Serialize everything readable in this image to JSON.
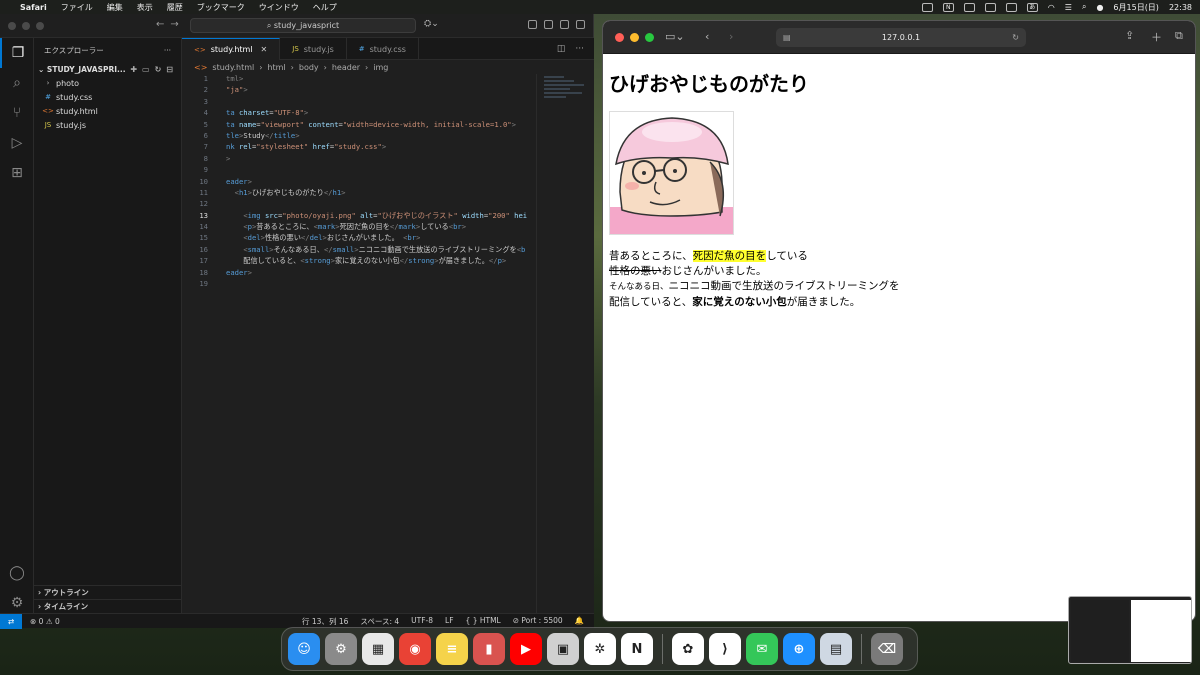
{
  "menubar": {
    "app": "Safari",
    "items": [
      "ファイル",
      "編集",
      "表示",
      "履歴",
      "ブックマーク",
      "ウインドウ",
      "ヘルプ"
    ],
    "ime": "あ",
    "date": "6月15日(日)",
    "time": "22:38"
  },
  "vscode": {
    "command_center": "study_javasprict",
    "explorer_title": "エクスプローラー",
    "root": "STUDY_JAVASPRI...",
    "tree": [
      {
        "name": "photo",
        "kind": "folder",
        "glyph": "›"
      },
      {
        "name": "study.css",
        "kind": "css",
        "glyph": "#"
      },
      {
        "name": "study.html",
        "kind": "html",
        "glyph": "<>"
      },
      {
        "name": "study.js",
        "kind": "js",
        "glyph": "JS"
      }
    ],
    "outline": "アウトライン",
    "timeline": "タイムライン",
    "tabs": [
      {
        "label": "study.html",
        "icon": "<>",
        "active": true
      },
      {
        "label": "study.js",
        "icon": "JS",
        "active": false
      },
      {
        "label": "study.css",
        "icon": "#",
        "active": false
      }
    ],
    "breadcrumb": [
      "study.html",
      "html",
      "body",
      "header",
      "img"
    ],
    "code_lines": [
      {
        "n": "1",
        "html": "<span class='p'>tml&gt;</span>"
      },
      {
        "n": "2",
        "html": "<span class='s'>\"ja\"</span><span class='p'>&gt;</span>"
      },
      {
        "n": "3",
        "html": ""
      },
      {
        "n": "4",
        "html": "<span class='t'>ta</span> <span class='a'>charset</span>=<span class='s'>\"UTF-8\"</span><span class='p'>&gt;</span>"
      },
      {
        "n": "5",
        "html": "<span class='t'>ta</span> <span class='a'>name</span>=<span class='s'>\"viewport\"</span> <span class='a'>content</span>=<span class='s'>\"width=device-width, initial-scale=1.0\"</span><span class='p'>&gt;</span>"
      },
      {
        "n": "6",
        "html": "<span class='t'>tle</span><span class='p'>&gt;</span>Study<span class='p'>&lt;/</span><span class='t'>title</span><span class='p'>&gt;</span>"
      },
      {
        "n": "7",
        "html": "<span class='t'>nk</span> <span class='a'>rel</span>=<span class='s'>\"stylesheet\"</span> <span class='a'>href</span>=<span class='s'>\"study.css\"</span><span class='p'>&gt;</span>"
      },
      {
        "n": "8",
        "html": "<span class='p'>&gt;</span>"
      },
      {
        "n": "9",
        "html": ""
      },
      {
        "n": "10",
        "html": "<span class='t'>eader</span><span class='p'>&gt;</span>"
      },
      {
        "n": "11",
        "html": "  <span class='p'>&lt;</span><span class='t'>h1</span><span class='p'>&gt;</span>ひげおやじものがたり<span class='p'>&lt;/</span><span class='t'>h1</span><span class='p'>&gt;</span>"
      },
      {
        "n": "12",
        "html": ""
      },
      {
        "n": "13",
        "html": "    <span class='p'>&lt;</span><span class='t'>img</span> <span class='a'>src</span>=<span class='s'>\"photo/oyaji.png\"</span> <span class='a'>alt</span>=<span class='s'>\"ひげおやじのイラスト\"</span> <span class='a'>width</span>=<span class='s'>\"200\"</span> <span class='a'>hei</span>"
      },
      {
        "n": "14",
        "html": "    <span class='p'>&lt;</span><span class='t'>p</span><span class='p'>&gt;</span>昔あるところに、<span class='p'>&lt;</span><span class='t'>mark</span><span class='p'>&gt;</span>死因だ魚の目を<span class='p'>&lt;/</span><span class='t'>mark</span><span class='p'>&gt;</span>している<span class='p'>&lt;</span><span class='t'>br</span><span class='p'>&gt;</span>"
      },
      {
        "n": "15",
        "html": "    <span class='p'>&lt;</span><span class='t'>del</span><span class='p'>&gt;</span>性格の悪い<span class='p'>&lt;/</span><span class='t'>del</span><span class='p'>&gt;</span>おじさんがいました。 <span class='p'>&lt;</span><span class='t'>br</span><span class='p'>&gt;</span>"
      },
      {
        "n": "16",
        "html": "    <span class='p'>&lt;</span><span class='t'>small</span><span class='p'>&gt;</span>そんなある日、<span class='p'>&lt;/</span><span class='t'>small</span><span class='p'>&gt;</span>ニコニコ動画で生放送のライブストリーミングを<span class='p'>&lt;</span><span class='t'>b</span>"
      },
      {
        "n": "17",
        "html": "    配信していると、<span class='p'>&lt;</span><span class='t'>strong</span><span class='p'>&gt;</span>家に覚えのない小包<span class='p'>&lt;/</span><span class='t'>strong</span><span class='p'>&gt;</span>が届きました。<span class='p'>&lt;/</span><span class='t'>p</span><span class='p'>&gt;</span>"
      },
      {
        "n": "18",
        "html": "<span class='t'>eader</span><span class='p'>&gt;</span>"
      },
      {
        "n": "19",
        "html": ""
      }
    ],
    "current_line": "13",
    "status": {
      "errors": "0",
      "warnings": "0",
      "position": "行 13、列 16",
      "spaces": "スペース: 4",
      "encoding": "UTF-8",
      "eol": "LF",
      "language": "HTML",
      "port": "Port : 5500"
    }
  },
  "safari": {
    "url": "127.0.0.1",
    "page": {
      "h1": "ひげおやじものがたり",
      "p1_before": "昔あるところに、",
      "p1_mark": "死因だ魚の目を",
      "p1_after": "している",
      "p2_del": "性格の悪い",
      "p2_after": "おじさんがいました。",
      "p3_small": "そんなある日、",
      "p3_after": "ニコニコ動画で生放送のライブストリーミングを",
      "p4_before": "配信していると、",
      "p4_strong": "家に覚えのない小包",
      "p4_after": "が届きました。"
    }
  },
  "dock": [
    {
      "name": "finder",
      "color": "#2a8ef0",
      "glyph": "☺"
    },
    {
      "name": "system-settings",
      "color": "#8a8a8a",
      "glyph": "⚙"
    },
    {
      "name": "launchpad",
      "color": "#e8e8e8",
      "glyph": "▦"
    },
    {
      "name": "chrome",
      "color": "#e94235",
      "glyph": "◉"
    },
    {
      "name": "notes",
      "color": "#f5d34a",
      "glyph": "≡"
    },
    {
      "name": "app-red",
      "color": "#d9534f",
      "glyph": "▮"
    },
    {
      "name": "youtube",
      "color": "#ff0000",
      "glyph": "▶"
    },
    {
      "name": "installer",
      "color": "#d0d0d0",
      "glyph": "▣"
    },
    {
      "name": "chatgpt",
      "color": "#ffffff",
      "glyph": "✲"
    },
    {
      "name": "notion",
      "color": "#ffffff",
      "glyph": "N"
    },
    {
      "name": "photos",
      "color": "#ffffff",
      "glyph": "✿"
    },
    {
      "name": "vscode",
      "color": "#ffffff",
      "glyph": "⟩"
    },
    {
      "name": "messages",
      "color": "#34c759",
      "glyph": "✉"
    },
    {
      "name": "safari",
      "color": "#1e90ff",
      "glyph": "⊕"
    },
    {
      "name": "preview",
      "color": "#cfd8e3",
      "glyph": "▤"
    },
    {
      "name": "trash",
      "color": "#7a7a7a",
      "glyph": "⌫"
    }
  ]
}
